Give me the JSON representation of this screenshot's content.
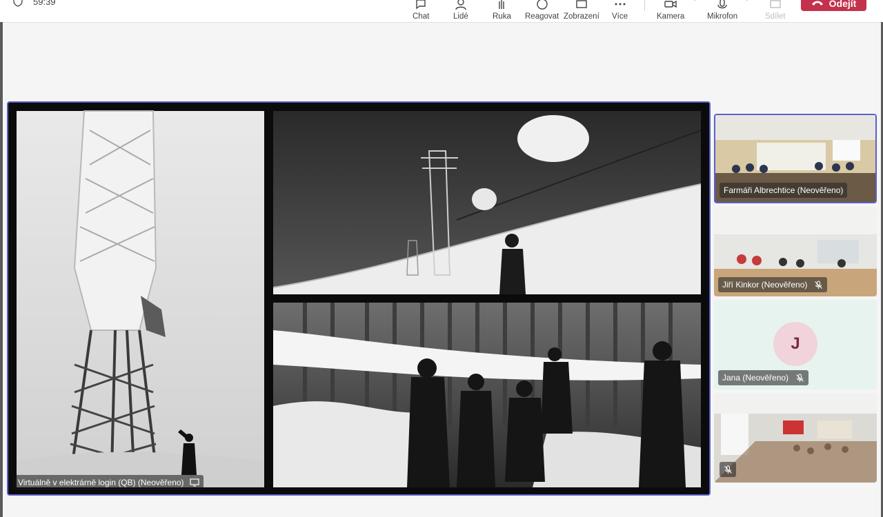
{
  "meeting": {
    "timer": "59:39"
  },
  "toolbar": {
    "chat": "Chat",
    "people": "Lidé",
    "raise_hand": "Ruka",
    "react": "Reagovat",
    "view": "Zobrazení",
    "more": "Více",
    "camera": "Kamera",
    "microphone": "Mikrofon",
    "share": "Sdílet",
    "leave": "Odejít"
  },
  "stage": {
    "presenter_label": "Virtuálně v elektrárně login (QB) (Neověřeno)"
  },
  "participants": [
    {
      "name": "Farmáři Albrechtice (Neověřeno)",
      "muted": false,
      "active": true
    },
    {
      "name": "Jiří Kinkor (Neověřeno)",
      "muted": true
    },
    {
      "name": "Jana (Neověřeno)",
      "muted": true,
      "initial": "J",
      "avatar_color": "#f1d3db"
    },
    {
      "name": "",
      "muted": true
    }
  ],
  "colors": {
    "accent": "#5b5fc7",
    "leave": "#c4314b"
  }
}
